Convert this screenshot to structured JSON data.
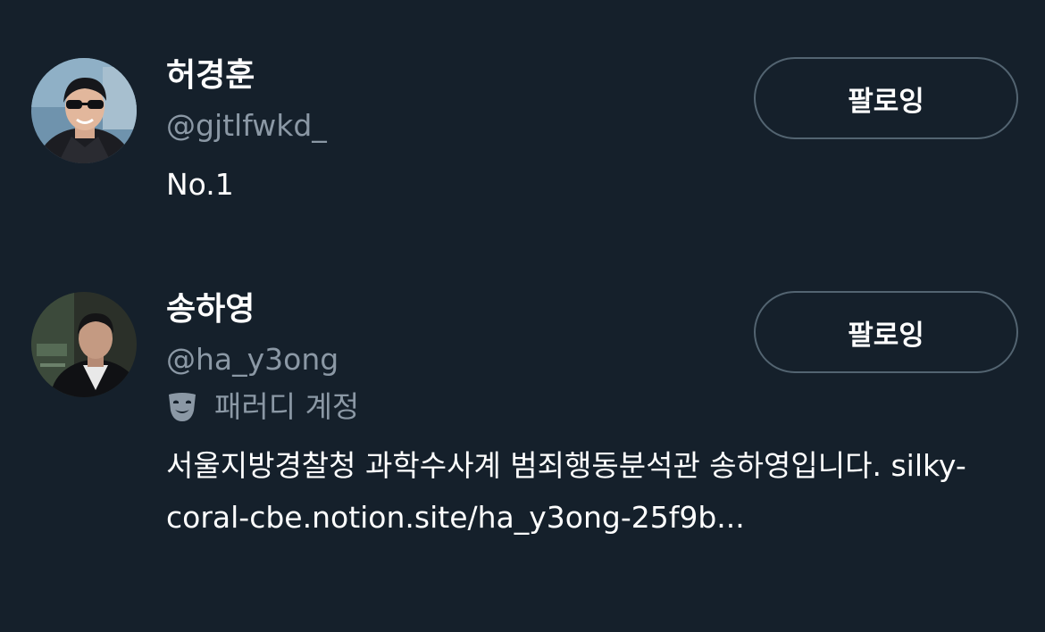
{
  "colors": {
    "background": "#15202b",
    "primary_text": "#ffffff",
    "secondary_text": "#8b98a5",
    "button_border": "#536471"
  },
  "users": [
    {
      "display_name": "허경훈",
      "handle": "@gjtlfwkd_",
      "follow_label": "팔로잉",
      "bio": "No.1"
    },
    {
      "display_name": "송하영",
      "handle": "@ha_y3ong",
      "follow_label": "팔로잉",
      "badge_icon": "theater-mask-icon",
      "badge_label": "패러디 계정",
      "bio_text": "서울지방경찰청 과학수사계 범죄행동분석관 송하영입니다.",
      "bio_link": "silky-coral-cbe.notion.site/ha_y3ong-25f9b..."
    }
  ]
}
